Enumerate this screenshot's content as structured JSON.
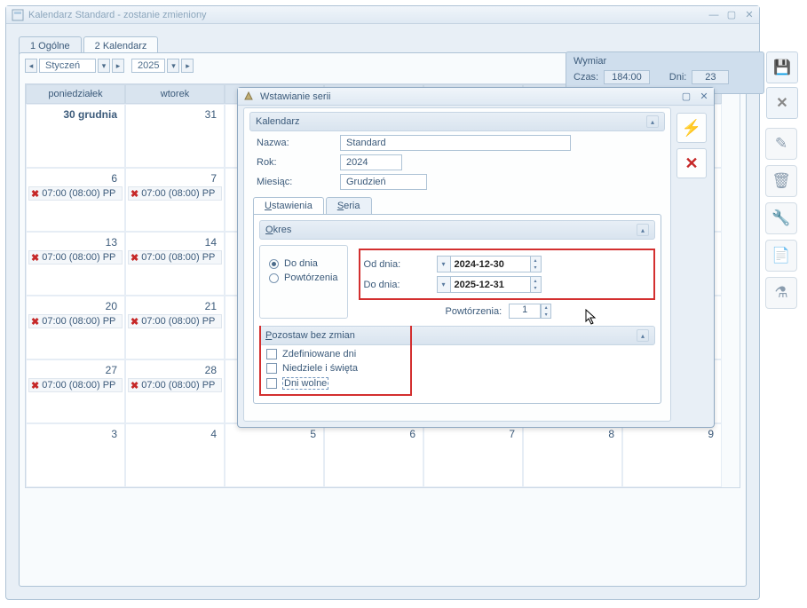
{
  "window": {
    "title": "Kalendarz Standard - zostanie zmieniony",
    "tabs": {
      "t1": "1 Ogólne",
      "t2": "2 Kalendarz"
    },
    "month": "Styczeń",
    "year": "2025"
  },
  "summary": {
    "title": "Wymiar",
    "czas_lbl": "Czas:",
    "czas_val": "184:00",
    "dni_lbl": "Dni:",
    "dni_val": "23"
  },
  "days": {
    "hdr": [
      "poniedziałek",
      "wtorek",
      "",
      "",
      "",
      "",
      ""
    ],
    "first_label": "30 grudnia",
    "grid": [
      [
        "",
        "31",
        "",
        "",
        "",
        "",
        ""
      ],
      [
        "6",
        "7",
        "",
        "",
        "",
        "",
        ""
      ],
      [
        "13",
        "14",
        "",
        "",
        "",
        "",
        ""
      ],
      [
        "20",
        "21",
        "",
        "",
        "",
        "",
        ""
      ],
      [
        "27",
        "28",
        "",
        "",
        "",
        "",
        ""
      ],
      [
        "3",
        "4",
        "5",
        "6",
        "7",
        "8",
        "9"
      ]
    ],
    "event": "07:00 (08:00) PP"
  },
  "dialog": {
    "title": "Wstawianie serii",
    "section_cal": "Kalendarz",
    "nazwa_lbl": "Nazwa:",
    "nazwa_val": "Standard",
    "rok_lbl": "Rok:",
    "rok_val": "2024",
    "mies_lbl": "Miesiąc:",
    "mies_val": "Grudzień",
    "tab_ust": "stawienia",
    "tab_ust_pre": "U",
    "tab_ser": "eria",
    "tab_ser_pre": "S",
    "okres": {
      "title_pre": "O",
      "title_rest": "kres",
      "opt1": "Do dnia",
      "opt2": "Powtórzenia",
      "od_lbl": "Od dnia:",
      "od_val": "2024-12-30",
      "do_lbl": "Do dnia:",
      "do_val": "2025-12-31",
      "pow_lbl": "Powtórzenia:",
      "pow_val": "1"
    },
    "pozostaw": {
      "title_pre": "P",
      "title_rest": "ozostaw bez zmian",
      "cb1": "Zdefiniowane dni",
      "cb2": "Niedziele i święta",
      "cb3": "Dni wolne"
    }
  }
}
